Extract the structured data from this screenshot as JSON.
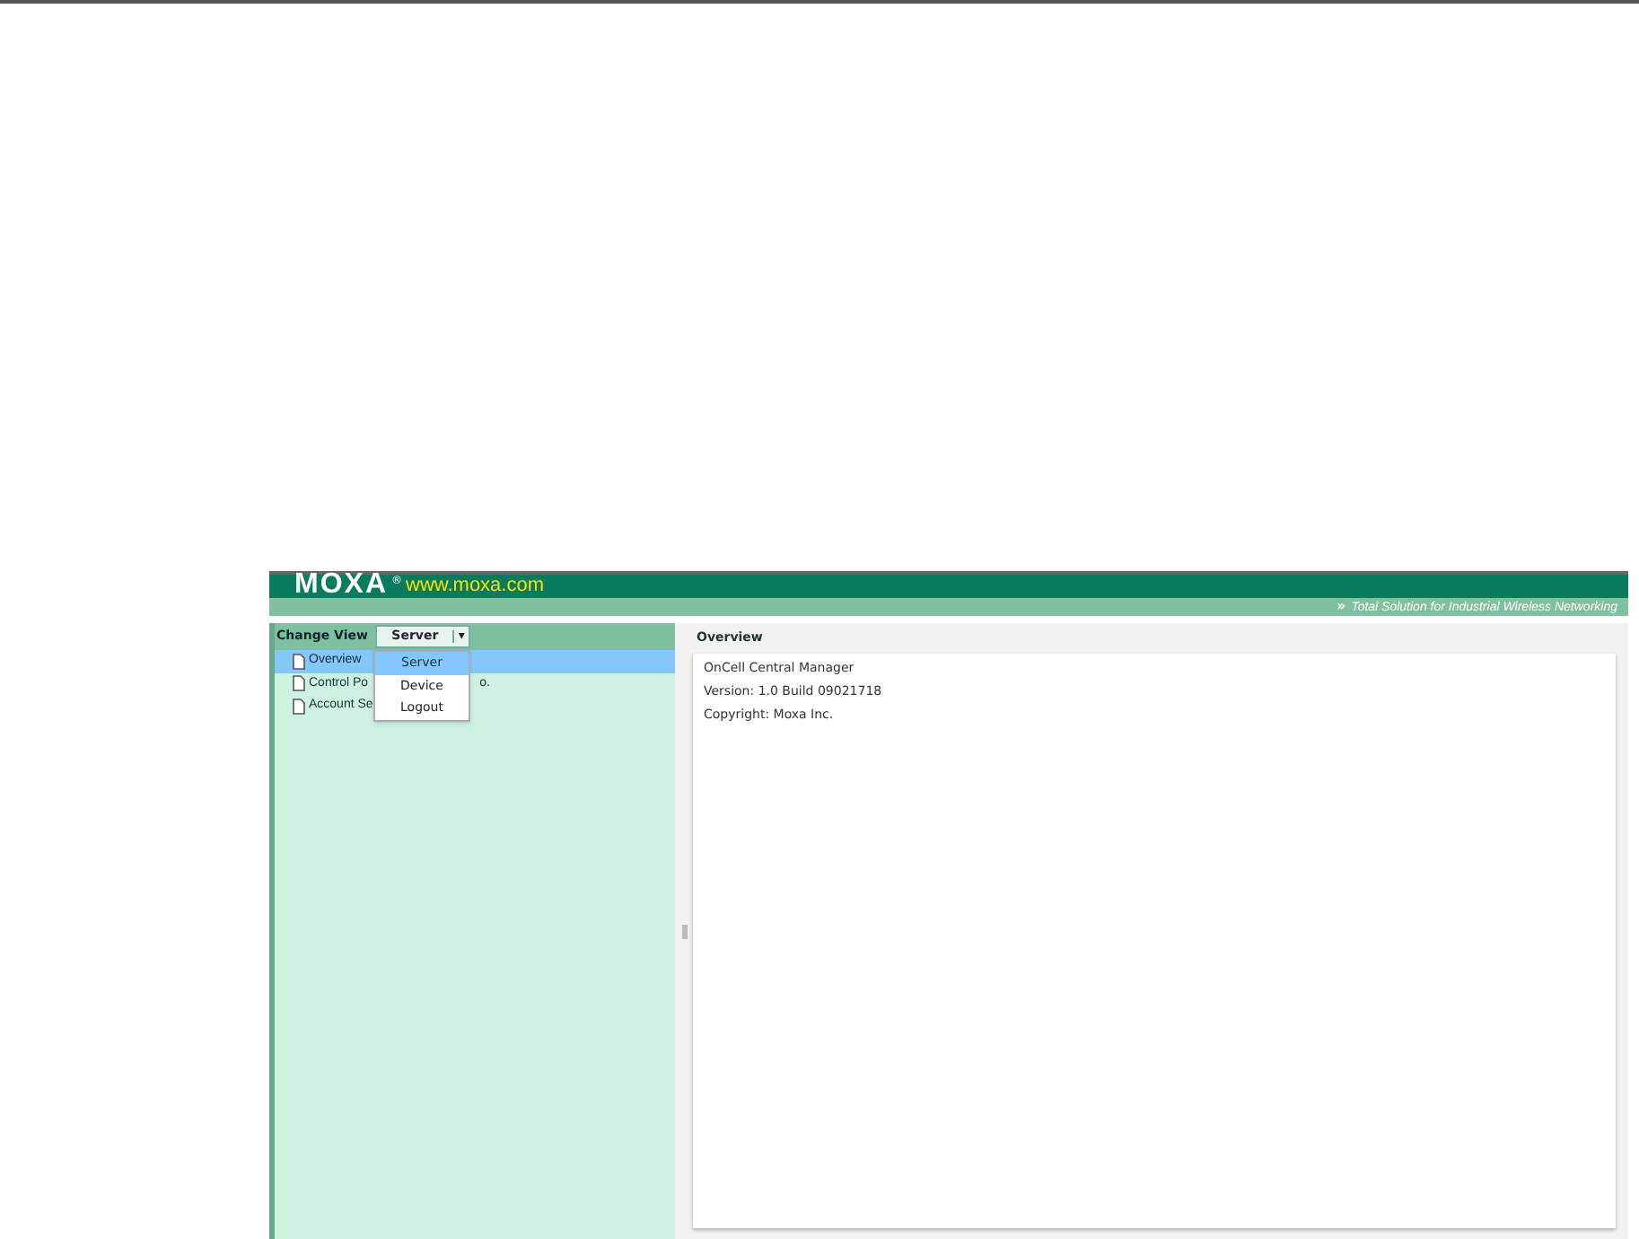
{
  "header": {
    "logo": "MOXA",
    "registered": "®",
    "website": "www.moxa.com",
    "tagline_icon": "»",
    "tagline": "Total Solution for Industrial Wireless Networking"
  },
  "sidebar": {
    "label": "Change View",
    "view_select": {
      "value": "Server",
      "arrow": "▾",
      "expanded": true,
      "options": [
        {
          "label": "Server",
          "selected": true
        },
        {
          "label": "Device",
          "selected": false
        },
        {
          "label": "Logout",
          "selected": false
        }
      ]
    },
    "items": [
      {
        "label_parts": [
          "Overview"
        ],
        "selected": true
      },
      {
        "label_parts": [
          "Control Po",
          "o."
        ],
        "selected": false
      },
      {
        "label_parts": [
          "Account Se"
        ],
        "selected": false
      }
    ]
  },
  "content": {
    "title": "Overview",
    "lines": [
      "OnCell Central Manager",
      "Version: 1.0 Build 09021718",
      "Copyright: Moxa Inc."
    ]
  }
}
